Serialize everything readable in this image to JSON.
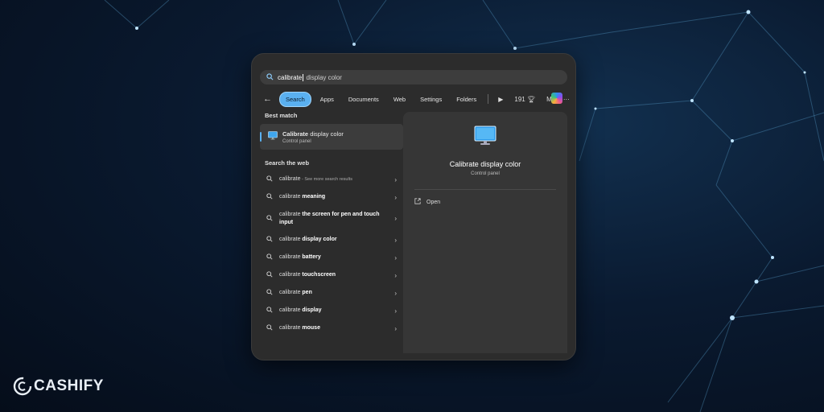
{
  "search": {
    "typed": "calibrate",
    "completion": "display color"
  },
  "filters": {
    "chips": [
      {
        "label": "Search",
        "active": true
      },
      {
        "label": "Apps",
        "active": false
      },
      {
        "label": "Documents",
        "active": false
      },
      {
        "label": "Web",
        "active": false
      },
      {
        "label": "Settings",
        "active": false
      },
      {
        "label": "Folders",
        "active": false
      }
    ],
    "points": "191",
    "profile_initial": "M",
    "more": "···"
  },
  "best_match": {
    "section_title": "Best match",
    "title_bold": "Calibrate",
    "title_rest": "display color",
    "subtitle": "Control panel"
  },
  "web": {
    "section_title": "Search the web",
    "items": [
      {
        "prefix": "calibrate",
        "bold": "",
        "hint": " - See more search results"
      },
      {
        "prefix": "calibrate ",
        "bold": "meaning",
        "hint": ""
      },
      {
        "prefix": "calibrate ",
        "bold": "the screen for pen and touch input",
        "hint": ""
      },
      {
        "prefix": "calibrate ",
        "bold": "display color",
        "hint": ""
      },
      {
        "prefix": "calibrate ",
        "bold": "battery",
        "hint": ""
      },
      {
        "prefix": "calibrate ",
        "bold": "touchscreen",
        "hint": ""
      },
      {
        "prefix": "calibrate ",
        "bold": "pen",
        "hint": ""
      },
      {
        "prefix": "calibrate ",
        "bold": "display",
        "hint": ""
      },
      {
        "prefix": "calibrate ",
        "bold": "mouse",
        "hint": ""
      }
    ]
  },
  "preview": {
    "title": "Calibrate display color",
    "subtitle": "Control panel",
    "open_label": "Open"
  },
  "brand": {
    "name": "CASHIFY"
  },
  "colors": {
    "accent": "#5ab0f0",
    "panel": "#2c2c2c",
    "preview": "#363636"
  },
  "icons": [
    "search-icon",
    "back-arrow-icon",
    "play-icon",
    "trophy-icon",
    "copilot-icon",
    "monitor-icon",
    "chevron-right-icon",
    "external-link-icon"
  ]
}
